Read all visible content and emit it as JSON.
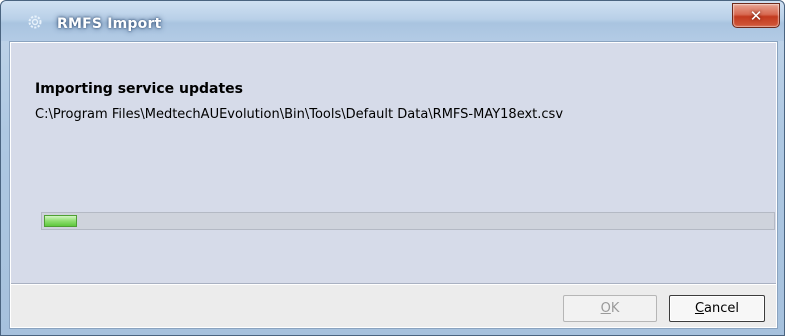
{
  "window": {
    "title": "RMFS Import",
    "close_glyph": "✕",
    "icon": "app-gear-icon"
  },
  "content": {
    "heading": "Importing service updates",
    "file_path": "C:\\Program Files\\MedtechAUEvolution\\Bin\\Tools\\Default Data\\RMFS-MAY18ext.csv"
  },
  "progress": {
    "fraction": 0.045
  },
  "buttons": {
    "ok": {
      "mnemonic": "O",
      "rest": "K",
      "enabled": false
    },
    "cancel": {
      "mnemonic": "C",
      "rest": "ancel",
      "enabled": true
    }
  },
  "colors": {
    "progress_fill": "#6ccf49",
    "title_text": "#ffffff",
    "close_button": "#c9462b"
  }
}
